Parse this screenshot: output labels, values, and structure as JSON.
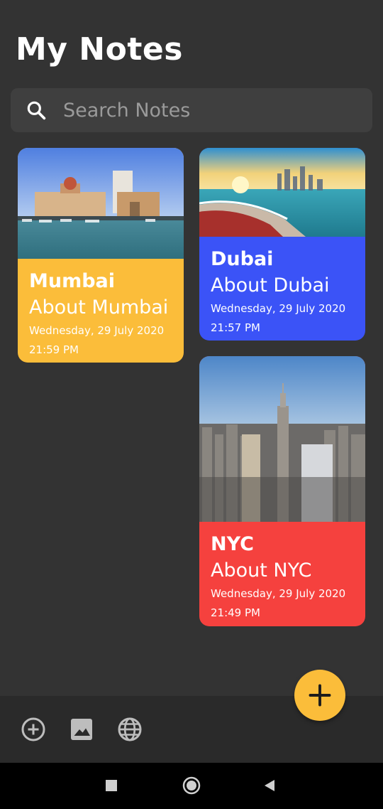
{
  "header": {
    "title": "My Notes"
  },
  "search": {
    "placeholder": "Search Notes",
    "icon": "search-icon"
  },
  "notes": [
    {
      "title": "Mumbai",
      "subtitle": "About Mumbai",
      "date": "Wednesday, 29 July 2020",
      "time": "21:59 PM",
      "color": "#fbbd3a"
    },
    {
      "title": "Dubai",
      "subtitle": "About Dubai",
      "date": "Wednesday, 29 July 2020",
      "time": "21:57 PM",
      "color": "#3b53f7"
    },
    {
      "title": "NYC",
      "subtitle": "About NYC",
      "date": "Wednesday, 29 July 2020",
      "time": "21:49 PM",
      "color": "#f5413e"
    }
  ],
  "bottom_bar": {
    "icons": [
      "add-circle-icon",
      "image-icon",
      "globe-icon"
    ],
    "fab_icon": "plus-icon",
    "fab_color": "#fbbd3a"
  },
  "nav": {
    "icons": [
      "recent-apps-icon",
      "home-icon",
      "back-icon"
    ]
  },
  "theme": {
    "background": "#333333",
    "surface": "#3f3f3f",
    "bottom_bar": "#2a2a2a"
  }
}
